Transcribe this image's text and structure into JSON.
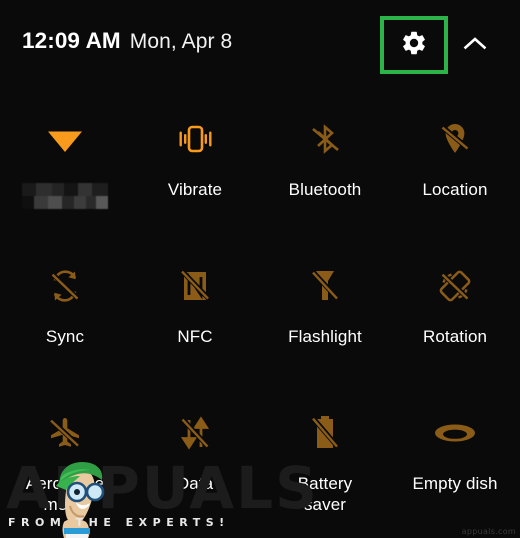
{
  "theme": {
    "background": "#0a0a0a",
    "icon_active": "#F89B1C",
    "icon_inactive": "#8a5c17",
    "label_color": "#ffffff",
    "highlight_color": "#2cb34a"
  },
  "header": {
    "time": "12:09 AM",
    "date": "Mon, Apr 8",
    "settings_icon": "gear-icon",
    "settings_label": "Settings",
    "expand_icon": "chevron-up-icon",
    "expand_label": "Collapse",
    "highlighted": true
  },
  "tiles": [
    {
      "id": "wifi",
      "label": "",
      "icon": "wifi-icon",
      "state": "on",
      "label_blurred": true
    },
    {
      "id": "vibrate",
      "label": "Vibrate",
      "icon": "vibrate-icon",
      "state": "on",
      "label_blurred": false
    },
    {
      "id": "bluetooth",
      "label": "Bluetooth",
      "icon": "bluetooth-off-icon",
      "state": "off",
      "label_blurred": false
    },
    {
      "id": "location",
      "label": "Location",
      "icon": "location-off-icon",
      "state": "off",
      "label_blurred": false
    },
    {
      "id": "sync",
      "label": "Sync",
      "icon": "sync-off-icon",
      "state": "off",
      "label_blurred": false
    },
    {
      "id": "nfc",
      "label": "NFC",
      "icon": "nfc-off-icon",
      "state": "off",
      "label_blurred": false
    },
    {
      "id": "flashlight",
      "label": "Flashlight",
      "icon": "flashlight-off-icon",
      "state": "off",
      "label_blurred": false
    },
    {
      "id": "rotation",
      "label": "Rotation",
      "icon": "rotation-off-icon",
      "state": "off",
      "label_blurred": false
    },
    {
      "id": "aeroplane-mode",
      "label": "Aeroplane\nmode",
      "icon": "airplane-off-icon",
      "state": "off",
      "label_blurred": false
    },
    {
      "id": "data",
      "label": "Data",
      "icon": "data-off-icon",
      "state": "off",
      "label_blurred": false
    },
    {
      "id": "battery-saver",
      "label": "Battery\nsaver",
      "icon": "battery-saver-off-icon",
      "state": "off",
      "label_blurred": false
    },
    {
      "id": "empty-dish",
      "label": "Empty dish",
      "icon": "dish-icon",
      "state": "off",
      "label_blurred": false
    }
  ],
  "watermark": {
    "brand": "APPUALS",
    "tagline": "FROM THE EXPERTS!",
    "mascot": "mascot-icon",
    "credit": "appuals.com"
  }
}
